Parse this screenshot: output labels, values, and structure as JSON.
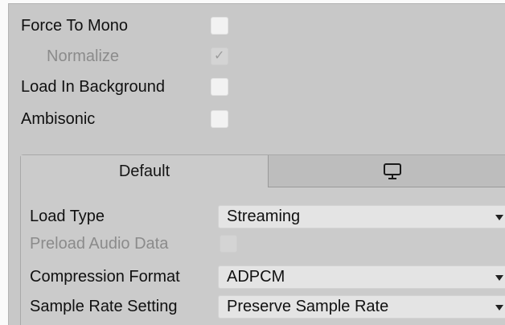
{
  "importer": {
    "force_to_mono_label": "Force To Mono",
    "normalize_label": "Normalize",
    "normalize_checked": true,
    "load_in_background_label": "Load In Background",
    "ambisonic_label": "Ambisonic"
  },
  "platform_tabs": {
    "default_label": "Default",
    "other_icon": "monitor-icon"
  },
  "settings": {
    "load_type_label": "Load Type",
    "load_type_value": "Streaming",
    "preload_audio_data_label": "Preload Audio Data",
    "compression_format_label": "Compression Format",
    "compression_format_value": "ADPCM",
    "sample_rate_setting_label": "Sample Rate Setting",
    "sample_rate_setting_value": "Preserve Sample Rate"
  }
}
